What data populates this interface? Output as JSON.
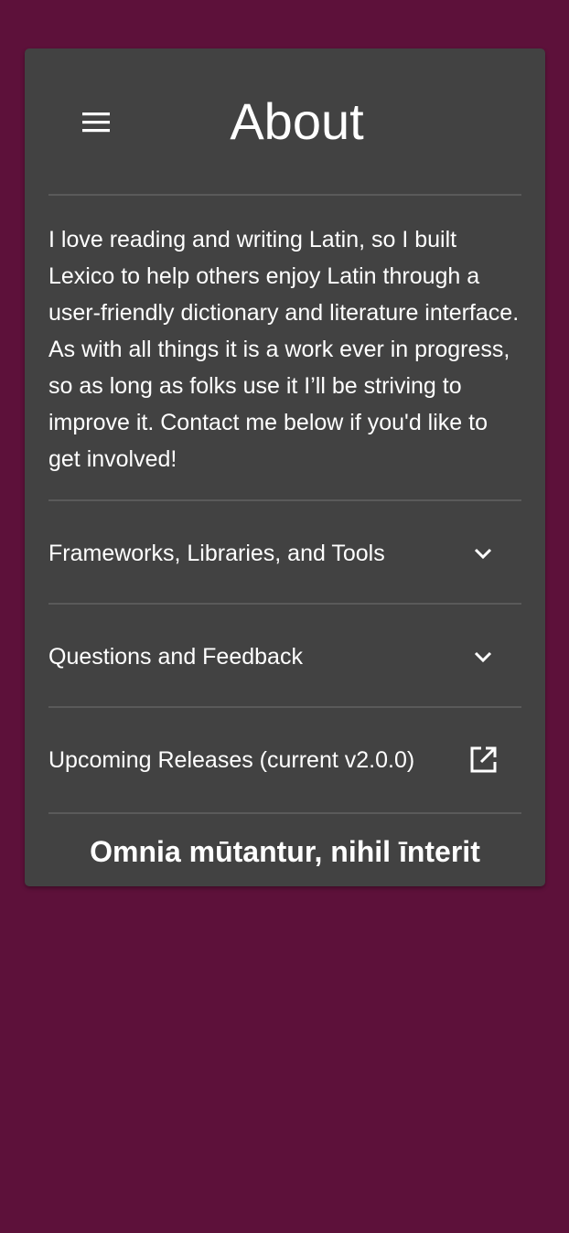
{
  "page": {
    "title": "About",
    "intro": "I love reading and writing Latin, so I built Lexico to help others enjoy Latin through a user-friendly dictionary and literature interface. As with all things it is a work ever in progress, so as long as folks use it I’ll be striving to improve it. Contact me below if you'd like to get involved!",
    "sections": [
      {
        "label": "Frameworks, Libraries, and Tools",
        "icon": "chevron-down-icon"
      },
      {
        "label": "Questions and Feedback",
        "icon": "chevron-down-icon"
      },
      {
        "label": "Upcoming Releases (current v2.0.0)",
        "icon": "open-in-new-icon"
      }
    ],
    "motto": "Omnia mūtantur, nihil īnterit"
  },
  "colors": {
    "background": "#5d113a",
    "card": "#424242",
    "divider": "#5a5a5a",
    "text": "#ffffff"
  },
  "icons": {
    "menu": "menu-icon"
  }
}
